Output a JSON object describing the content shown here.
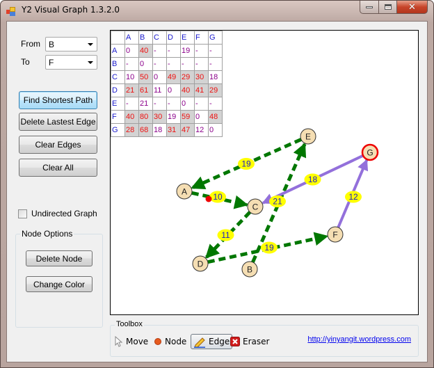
{
  "window": {
    "title": "Y2 Visual Graph 1.3.2.0",
    "controls": {
      "minimize": "minimize",
      "maximize": "maximize",
      "close": "✕"
    }
  },
  "controls": {
    "from_label": "From",
    "from_value": "B",
    "to_label": "To",
    "to_value": "F",
    "buttons": {
      "find_shortest_path": "Find Shortest Path",
      "delete_latest_edge": "Delete Lastest Edge",
      "clear_edges": "Clear Edges",
      "clear_all": "Clear All"
    },
    "undirected_label": "Undirected Graph",
    "undirected_checked": false,
    "node_options": {
      "title": "Node Options",
      "delete_node": "Delete Node",
      "change_color": "Change Color"
    }
  },
  "matrix": {
    "columns": [
      "A",
      "B",
      "C",
      "D",
      "E",
      "F",
      "G"
    ],
    "rows": [
      {
        "label": "A",
        "cells": [
          [
            "0",
            "pur"
          ],
          [
            "40",
            "red"
          ],
          [
            "-",
            "pur"
          ],
          [
            "-",
            "pur"
          ],
          [
            "19",
            "pur"
          ],
          [
            "-",
            "pur"
          ],
          [
            "-",
            "pur"
          ]
        ]
      },
      {
        "label": "B",
        "cells": [
          [
            "-",
            "pur"
          ],
          [
            "0",
            "pur"
          ],
          [
            "-",
            "pur"
          ],
          [
            "-",
            "pur"
          ],
          [
            "-",
            "pur"
          ],
          [
            "-",
            "pur"
          ],
          [
            "-",
            "pur"
          ]
        ]
      },
      {
        "label": "C",
        "cells": [
          [
            "10",
            "pur"
          ],
          [
            "50",
            "red"
          ],
          [
            "0",
            "pur"
          ],
          [
            "49",
            "red"
          ],
          [
            "29",
            "red"
          ],
          [
            "30",
            "red"
          ],
          [
            "18",
            "pur"
          ]
        ]
      },
      {
        "label": "D",
        "cells": [
          [
            "21",
            "red"
          ],
          [
            "61",
            "red"
          ],
          [
            "11",
            "pur"
          ],
          [
            "0",
            "pur"
          ],
          [
            "40",
            "red"
          ],
          [
            "41",
            "red"
          ],
          [
            "29",
            "red"
          ]
        ]
      },
      {
        "label": "E",
        "cells": [
          [
            "-",
            "pur"
          ],
          [
            "21",
            "pur"
          ],
          [
            "-",
            "pur"
          ],
          [
            "-",
            "pur"
          ],
          [
            "0",
            "pur"
          ],
          [
            "-",
            "pur"
          ],
          [
            "-",
            "pur"
          ]
        ]
      },
      {
        "label": "F",
        "cells": [
          [
            "40",
            "red"
          ],
          [
            "80",
            "red"
          ],
          [
            "30",
            "red"
          ],
          [
            "19",
            "pur"
          ],
          [
            "59",
            "red"
          ],
          [
            "0",
            "pur"
          ],
          [
            "48",
            "red"
          ]
        ]
      },
      {
        "label": "G",
        "cells": [
          [
            "28",
            "red"
          ],
          [
            "68",
            "red"
          ],
          [
            "18",
            "pur"
          ],
          [
            "31",
            "red"
          ],
          [
            "47",
            "red"
          ],
          [
            "12",
            "pur"
          ],
          [
            "0",
            "pur"
          ]
        ]
      }
    ]
  },
  "graph": {
    "colors": {
      "node_fill": "#f5deb3",
      "node_stroke": "#333333",
      "highlight_stroke": "#ee0000",
      "edge_normal": "#007700",
      "edge_path": "#9370db",
      "label_bg": "#ffff00",
      "label_text": "#1a1acc",
      "marker": "#ee0000"
    },
    "nodes": [
      {
        "id": "A",
        "label": "A",
        "highlight": false
      },
      {
        "id": "B",
        "label": "B",
        "highlight": false
      },
      {
        "id": "C",
        "label": "C",
        "highlight": false
      },
      {
        "id": "D",
        "label": "D",
        "highlight": false
      },
      {
        "id": "E",
        "label": "E",
        "highlight": false
      },
      {
        "id": "F",
        "label": "F",
        "highlight": false
      },
      {
        "id": "G",
        "label": "G",
        "highlight": true
      }
    ],
    "edges": [
      {
        "from": "E",
        "to": "A",
        "weight": "19",
        "style": "normal"
      },
      {
        "from": "A",
        "to": "C",
        "weight": "10",
        "style": "normal"
      },
      {
        "from": "C",
        "to": "D",
        "weight": "11",
        "style": "normal"
      },
      {
        "from": "B",
        "to": "E",
        "weight": "21",
        "style": "normal"
      },
      {
        "from": "D",
        "to": "F",
        "weight": "19",
        "style": "normal"
      },
      {
        "from": "G",
        "to": "C",
        "weight": "18",
        "style": "path"
      },
      {
        "from": "C",
        "to": "G",
        "weight": "18",
        "style": "path"
      },
      {
        "from": "F",
        "to": "G",
        "weight": "12",
        "style": "path"
      }
    ]
  },
  "toolbox": {
    "title": "Toolbox",
    "tools": [
      {
        "label": "Move",
        "icon": "cursor-icon",
        "selected": false
      },
      {
        "label": "Node",
        "icon": "node-dot-icon",
        "selected": false
      },
      {
        "label": "Edge",
        "icon": "pencil-icon",
        "selected": true
      },
      {
        "label": "Eraser",
        "icon": "eraser-x-icon",
        "selected": false
      }
    ],
    "link": "http://yinyangit.wordpress.com"
  }
}
